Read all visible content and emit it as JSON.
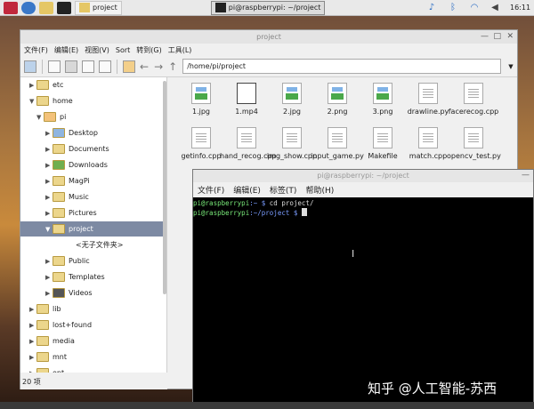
{
  "taskbar": {
    "buttons": [
      {
        "label": "project"
      },
      {
        "label": "pi@raspberrypi: ~/project"
      }
    ],
    "clock": "16:11"
  },
  "file_manager": {
    "title": "project",
    "menu": [
      "文件(F)",
      "编辑(E)",
      "视图(V)",
      "Sort",
      "转到(G)",
      "工具(L)"
    ],
    "path": "/home/pi/project",
    "tree": [
      {
        "label": "etc"
      },
      {
        "label": "home"
      },
      {
        "label": "pi"
      },
      {
        "label": "Desktop"
      },
      {
        "label": "Documents"
      },
      {
        "label": "Downloads"
      },
      {
        "label": "MagPi"
      },
      {
        "label": "Music"
      },
      {
        "label": "Pictures"
      },
      {
        "label": "project"
      },
      {
        "label": "<无子文件夹>"
      },
      {
        "label": "Public"
      },
      {
        "label": "Templates"
      },
      {
        "label": "Videos"
      },
      {
        "label": "lib"
      },
      {
        "label": "lost+found"
      },
      {
        "label": "media"
      },
      {
        "label": "mnt"
      },
      {
        "label": "opt"
      }
    ],
    "files": [
      {
        "name": "1.jpg",
        "icon": "image-icon"
      },
      {
        "name": "1.mp4",
        "icon": "video-icon"
      },
      {
        "name": "2.jpg",
        "icon": "image-icon"
      },
      {
        "name": "2.png",
        "icon": "image-icon"
      },
      {
        "name": "3.png",
        "icon": "image-icon"
      },
      {
        "name": "drawline.py",
        "icon": "document-icon"
      },
      {
        "name": "facerecog.cpp",
        "icon": "document-icon"
      },
      {
        "name": "getinfo.cpp",
        "icon": "document-icon"
      },
      {
        "name": "hand_recog.cpp",
        "icon": "document-icon"
      },
      {
        "name": "img_show.cpp",
        "icon": "document-icon"
      },
      {
        "name": "input_game.py",
        "icon": "document-icon"
      },
      {
        "name": "Makefile",
        "icon": "document-icon"
      },
      {
        "name": "match.cpp",
        "icon": "document-icon"
      },
      {
        "name": "opencv_test.py",
        "icon": "document-icon"
      }
    ],
    "status": "20 项"
  },
  "terminal": {
    "title": "pi@raspberrypi: ~/project",
    "menu": [
      "文件(F)",
      "编辑(E)",
      "标签(T)",
      "帮助(H)"
    ],
    "lines": [
      {
        "prompt": "pi@raspberrypi",
        "path": ":~ $",
        "cmd": " cd project/"
      },
      {
        "prompt": "pi@raspberrypi",
        "path": ":~/project $",
        "cmd": " "
      }
    ]
  },
  "watermark": "知乎 @人工智能-苏西",
  "colors": {
    "selection": "#7d8aa3",
    "terminal_bg": "#000000",
    "prompt": "#78e878",
    "path": "#7a9cff"
  }
}
